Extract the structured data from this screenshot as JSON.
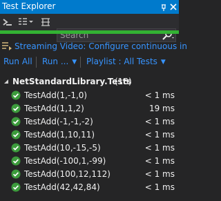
{
  "window": {
    "title": "Test Explorer"
  },
  "search": {
    "placeholder": "Search"
  },
  "progress": {
    "fraction": 1.0,
    "color": "#33b233"
  },
  "playlist_bar": {
    "text": "Streaming Video: Configure continuous in"
  },
  "actions": {
    "run_all": "Run All",
    "run": "Run ...",
    "playlist": "Playlist : All Tests"
  },
  "tree": {
    "group_name": "NetStandardLibrary.Tests",
    "group_count": "(18)",
    "tests": [
      {
        "name": "TestAdd(1,-1,0)",
        "duration": "< 1 ms"
      },
      {
        "name": "TestAdd(1,1,2)",
        "duration": "19 ms"
      },
      {
        "name": "TestAdd(-1,-1,-2)",
        "duration": "< 1 ms"
      },
      {
        "name": "TestAdd(1,10,11)",
        "duration": "< 1 ms"
      },
      {
        "name": "TestAdd(10,-15,-5)",
        "duration": "< 1 ms"
      },
      {
        "name": "TestAdd(-100,1,-99)",
        "duration": "< 1 ms"
      },
      {
        "name": "TestAdd(100,12,112)",
        "duration": "< 1 ms"
      },
      {
        "name": "TestAdd(42,42,84)",
        "duration": "< 1 ms"
      }
    ]
  },
  "colors": {
    "accent": "#007acc",
    "link": "#3794ff",
    "pass": "#3c9b3c",
    "background": "#252526"
  },
  "icons": {
    "title": [
      "pin-icon",
      "close-icon"
    ],
    "toolbar": [
      "run-icon",
      "group-by-icon",
      "dropdown-icon",
      "settings-icon",
      "search-icon"
    ],
    "playlist": "playlist-icon",
    "tree": [
      "expander-icon",
      "passed-icon"
    ]
  }
}
